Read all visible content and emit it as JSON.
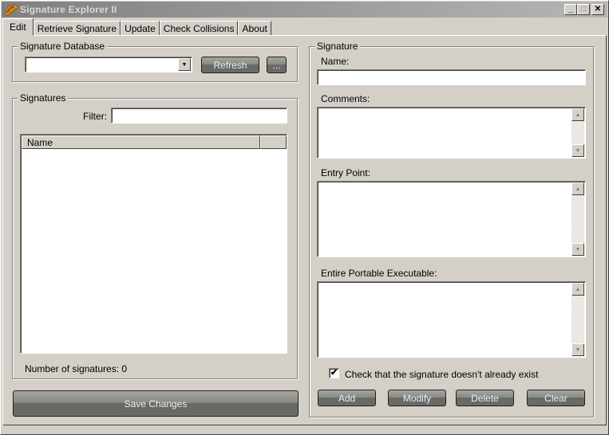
{
  "window": {
    "title": "Signature Explorer II",
    "icon": "taco-icon",
    "controls": {
      "minimize": "_",
      "maximize": "□",
      "close": "✕"
    }
  },
  "tabs": [
    {
      "label": "Edit",
      "active": true
    },
    {
      "label": "Retrieve Signature",
      "active": false
    },
    {
      "label": "Update",
      "active": false
    },
    {
      "label": "Check Collisions",
      "active": false
    },
    {
      "label": "About",
      "active": false
    }
  ],
  "database": {
    "group_label": "Signature Database",
    "combo_value": "",
    "refresh_label": "Refresh",
    "browse_label": "..."
  },
  "signatures": {
    "group_label": "Signatures",
    "filter_label": "Filter:",
    "filter_value": "",
    "columns": [
      "Name",
      ""
    ],
    "rows": [],
    "count_text": "Number of signatures: 0"
  },
  "save_label": "Save Changes",
  "signature": {
    "group_label": "Signature",
    "name_label": "Name:",
    "name_value": "",
    "comments_label": "Comments:",
    "comments_value": "",
    "entry_point_label": "Entry Point:",
    "entry_point_value": "",
    "pe_label": "Entire Portable Executable:",
    "pe_value": "",
    "check_label": "Check that the signature doesn't already exist",
    "check_checked": true,
    "check_glyph": "✔",
    "buttons": {
      "add": "Add",
      "modify": "Modify",
      "delete": "Delete",
      "clear": "Clear"
    }
  },
  "scroll_arrows": {
    "up": "▲",
    "down": "▼"
  },
  "combo_arrow": "▼"
}
